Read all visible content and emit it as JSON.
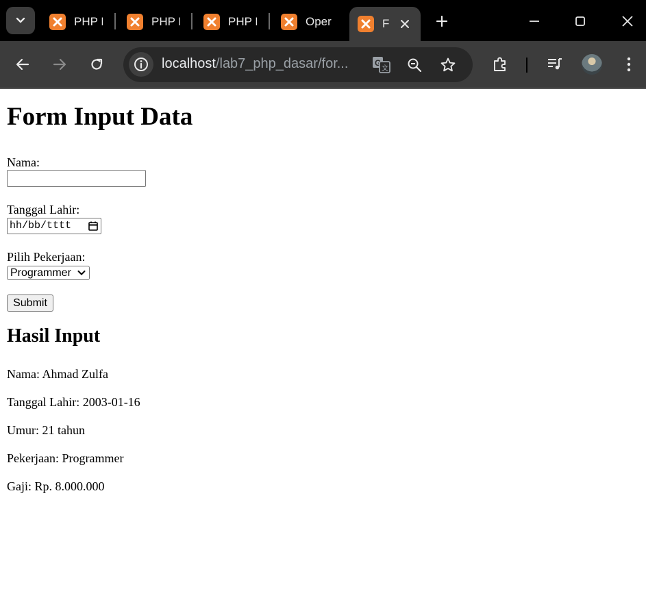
{
  "browser": {
    "tabs": [
      {
        "label": "PHP D",
        "active": false
      },
      {
        "label": "PHP D",
        "active": false
      },
      {
        "label": "PHP D",
        "active": false
      },
      {
        "label": "Oper",
        "active": false
      },
      {
        "label": "F",
        "active": true
      }
    ],
    "url_host": "localhost",
    "url_path": "/lab7_php_dasar/for..."
  },
  "form": {
    "title": "Form Input Data",
    "nama_label": "Nama:",
    "nama_value": "",
    "tanggal_label": "Tanggal Lahir:",
    "tanggal_placeholder": "hh/bb/tttt",
    "pekerjaan_label": "Pilih Pekerjaan:",
    "pekerjaan_selected": "Programmer",
    "submit_label": "Submit"
  },
  "result": {
    "title": "Hasil Input",
    "nama": "Nama: Ahmad Zulfa",
    "tanggal": "Tanggal Lahir: 2003-01-16",
    "umur": "Umur: 21 tahun",
    "pekerjaan": "Pekerjaan: Programmer",
    "gaji": "Gaji: Rp. 8.000.000"
  },
  "colors": {
    "xampp_orange": "#f0802f",
    "chrome_dark": "#3c3c3c"
  }
}
